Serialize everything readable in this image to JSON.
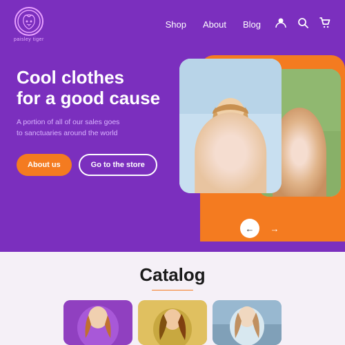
{
  "header": {
    "logo_brand": "paisley tiger",
    "logo_symbol": "🐯",
    "nav": {
      "shop_label": "Shop",
      "about_label": "About",
      "blog_label": "Blog"
    },
    "icons": {
      "account": "👤",
      "search": "🔍",
      "cart": "🛒"
    }
  },
  "hero": {
    "title_line1": "Cool clothes",
    "title_line2": "for a good cause",
    "subtitle": "A portion of all of our sales goes to sanctuaries around the world",
    "btn_about": "About us",
    "btn_store": "Go to the store",
    "arrow_prev": "←",
    "arrow_next": "→"
  },
  "catalog": {
    "title": "Catalog",
    "cards": [
      {
        "id": 1,
        "alt": "Product 1 - purple hoodie model"
      },
      {
        "id": 2,
        "alt": "Product 2 - model with colorful hair"
      },
      {
        "id": 3,
        "alt": "Product 3 - outdoor model"
      }
    ]
  },
  "colors": {
    "brand_purple": "#7B2FBE",
    "brand_orange": "#F47B20",
    "background_light": "#f5f0f7"
  }
}
